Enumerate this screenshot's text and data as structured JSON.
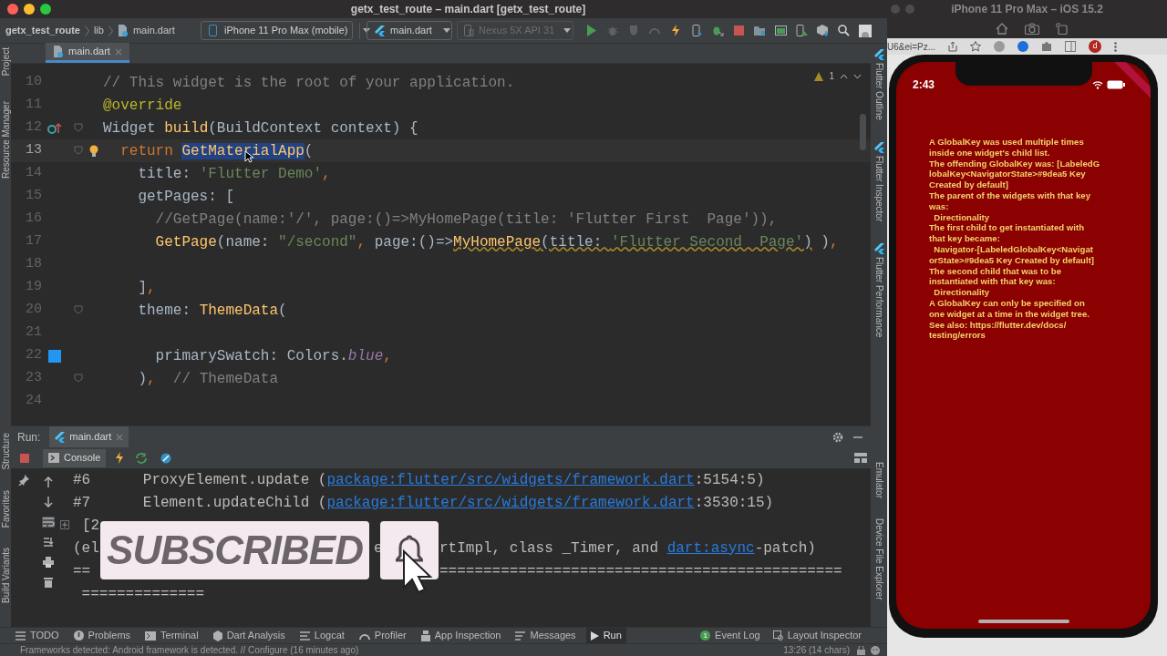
{
  "ide": {
    "title": "getx_test_route – main.dart [getx_test_route]",
    "breadcrumbs": [
      "getx_test_route",
      "lib",
      "main.dart"
    ],
    "device_selector": "iPhone 11 Pro Max (mobile)",
    "run_config": "main.dart",
    "emulator_selector": {
      "label": "Nexus 5X API 31",
      "disabled": true
    },
    "left_stripe": {
      "top": [
        "Project",
        "Resource Manager"
      ],
      "bottom": [
        "Structure",
        "Favorites",
        "Build Variants"
      ]
    },
    "right_stripe": {
      "top": [
        "Flutter Outline",
        "Flutter Inspector",
        "Flutter Performance"
      ],
      "bottom": [
        "Emulator",
        "Device File Explorer"
      ]
    },
    "editor_tabs": [
      {
        "label": "main.dart",
        "selected": true
      }
    ],
    "editor": {
      "warning_count": "1",
      "lines": [
        {
          "number": "10",
          "kind": "code",
          "current": false,
          "fold": false,
          "tokens": [
            {
              "kind": "comment",
              "text": "// This widget is the root of your application."
            }
          ]
        },
        {
          "number": "11",
          "kind": "code",
          "current": false,
          "fold": false,
          "tokens": [
            {
              "kind": "annotation",
              "text": "@override"
            }
          ]
        },
        {
          "number": "12",
          "kind": "override",
          "current": false,
          "fold": true,
          "tokens": [
            {
              "kind": "plain",
              "text": "Widget "
            },
            {
              "kind": "function",
              "text": "build"
            },
            {
              "kind": "plain",
              "text": "(BuildContext context) {"
            }
          ]
        },
        {
          "number": "13",
          "kind": "bulb",
          "current": true,
          "fold": true,
          "tokens": [
            {
              "kind": "keyword",
              "text": "  return "
            },
            {
              "kind": "selected",
              "text": "GetMaterialApp"
            },
            {
              "kind": "plain",
              "text": "("
            }
          ]
        },
        {
          "number": "14",
          "kind": "code",
          "current": false,
          "fold": false,
          "tokens": [
            {
              "kind": "plain",
              "text": "    title: "
            },
            {
              "kind": "string",
              "text": "'Flutter Demo'"
            },
            {
              "kind": "keyword",
              "text": ","
            }
          ]
        },
        {
          "number": "15",
          "kind": "code",
          "current": false,
          "fold": false,
          "tokens": [
            {
              "kind": "plain",
              "text": "    getPages: ["
            }
          ]
        },
        {
          "number": "16",
          "kind": "code",
          "current": false,
          "fold": false,
          "tokens": [
            {
              "kind": "comment",
              "text": "      //GetPage(name:'/', page:()=>MyHomePage(title: 'Flutter First  Page')),"
            }
          ]
        },
        {
          "number": "17",
          "kind": "code",
          "current": false,
          "fold": false,
          "tokens": [
            {
              "kind": "function",
              "text": "      GetPage"
            },
            {
              "kind": "plain",
              "text": "(name: "
            },
            {
              "kind": "string",
              "text": "\"/second\""
            },
            {
              "kind": "keyword",
              "text": ","
            },
            {
              "kind": "plain",
              "text": " page:()=>"
            },
            {
              "kind": "function-warn",
              "text": "MyHomePage"
            },
            {
              "kind": "plain-warn",
              "text": "(title: "
            },
            {
              "kind": "string-warn",
              "text": "'Flutter Second  Page'"
            },
            {
              "kind": "plain-warn",
              "text": ")"
            },
            {
              "kind": "plain",
              "text": " )"
            },
            {
              "kind": "keyword",
              "text": ","
            }
          ]
        },
        {
          "number": "18",
          "kind": "code",
          "current": false,
          "fold": false
        },
        {
          "number": "19",
          "kind": "code",
          "current": false,
          "fold": false,
          "tokens": [
            {
              "kind": "plain",
              "text": "    ]"
            },
            {
              "kind": "keyword",
              "text": ","
            }
          ]
        },
        {
          "number": "20",
          "kind": "code",
          "current": false,
          "fold": true,
          "tokens": [
            {
              "kind": "plain",
              "text": "    theme: "
            },
            {
              "kind": "function",
              "text": "ThemeData"
            },
            {
              "kind": "plain",
              "text": "("
            }
          ]
        },
        {
          "number": "21",
          "kind": "code",
          "current": false,
          "fold": false
        },
        {
          "number": "22",
          "kind": "color",
          "current": false,
          "fold": false,
          "tokens": [
            {
              "kind": "plain",
              "text": "      primarySwatch: Colors."
            },
            {
              "kind": "constant",
              "text": "blue"
            },
            {
              "kind": "keyword",
              "text": ","
            }
          ]
        },
        {
          "number": "23",
          "kind": "code",
          "current": false,
          "fold": true,
          "tokens": [
            {
              "kind": "plain",
              "text": "    )"
            },
            {
              "kind": "keyword",
              "text": ","
            },
            {
              "kind": "comment",
              "text": "  // ThemeData"
            }
          ]
        },
        {
          "number": "24",
          "kind": "code",
          "current": false,
          "fold": false
        }
      ]
    },
    "run_panel": {
      "label": "Run:",
      "tabs": [
        {
          "label": "main.dart",
          "selected": true
        }
      ],
      "console_tab": {
        "label": "Console",
        "selected": true
      },
      "console_lines": [
        {
          "collapsed": false,
          "segments": [
            {
              "kind": "text",
              "text": "#6      ProxyElement.update ("
            },
            {
              "kind": "link",
              "text": "package:flutter/src/widgets/framework.dart"
            },
            {
              "kind": "text",
              "text": ":5154:5)"
            }
          ]
        },
        {
          "collapsed": false,
          "segments": [
            {
              "kind": "text",
              "text": "#7      Element.updateChild ("
            },
            {
              "kind": "link",
              "text": "package:flutter/src/widgets/framework.dart"
            },
            {
              "kind": "text",
              "text": ":3530:15)"
            }
          ]
        },
        {
          "collapsed": true,
          "left": [
            {
              "kind": "text",
              "text": "[2"
            }
          ]
        },
        {
          "collapsed": false,
          "left": [
            {
              "kind": "text",
              "text": "(el"
            }
          ],
          "middle": [
            {
              "kind": "text",
              "text": "e"
            }
          ],
          "right": [
            {
              "kind": "text",
              "text": "rtImpl, class _Timer, and "
            },
            {
              "kind": "link",
              "text": "dart:async"
            },
            {
              "kind": "text",
              "text": "-patch)"
            }
          ]
        },
        {
          "collapsed": false,
          "left": [
            {
              "kind": "text",
              "text": "=="
            }
          ],
          "right": [
            {
              "kind": "text",
              "text": "=============================================="
            }
          ]
        },
        {
          "collapsed": false,
          "segments": [
            {
              "kind": "text",
              "text": " =============="
            }
          ]
        }
      ]
    },
    "overlay": {
      "label": "SUBSCRIBED"
    },
    "tool_tabs_left": [
      {
        "label": "TODO",
        "selected": false
      },
      {
        "label": "Problems",
        "selected": false
      },
      {
        "label": "Terminal",
        "selected": false
      },
      {
        "label": "Dart Analysis",
        "selected": false
      },
      {
        "label": "Logcat",
        "selected": false
      },
      {
        "label": "Profiler",
        "selected": false
      },
      {
        "label": "App Inspection",
        "selected": false
      },
      {
        "label": "Messages",
        "selected": false
      },
      {
        "label": "Run",
        "selected": true
      }
    ],
    "tool_tabs_right": [
      {
        "label": "Event Log",
        "badge": "1"
      },
      {
        "label": "Layout Inspector"
      }
    ],
    "status_bar": {
      "message": "Frameworks detected: Android framework is detected. // Configure (16 minutes ago)",
      "position": "13:26 (14 chars)"
    }
  },
  "simulator": {
    "title": "iPhone 11 Pro Max – iOS 15.2",
    "browser_url": "U6&ei=Pz...",
    "browser_avatar": "d",
    "phone": {
      "time": "2:43",
      "error_lines": [
        "A GlobalKey was used multiple times",
        "inside one widget's child list.",
        "The offending GlobalKey was: [LabeledG",
        "lobalKey<NavigatorState>#9dea5 Key",
        "Created by default]",
        "The parent of the widgets with that key",
        "was:",
        "  Directionality",
        "The first child to get instantiated with",
        "that key became:",
        "  Navigator-[LabeledGlobalKey<Navigat",
        "orState>#9dea5 Key Created by default]",
        "The second child that was to be",
        "instantiated with that key was:",
        "  Directionality",
        "A GlobalKey can only be specified on",
        "one widget at a time in the widget tree.",
        "See also: https://flutter.dev/docs/",
        "testing/errors"
      ]
    }
  }
}
